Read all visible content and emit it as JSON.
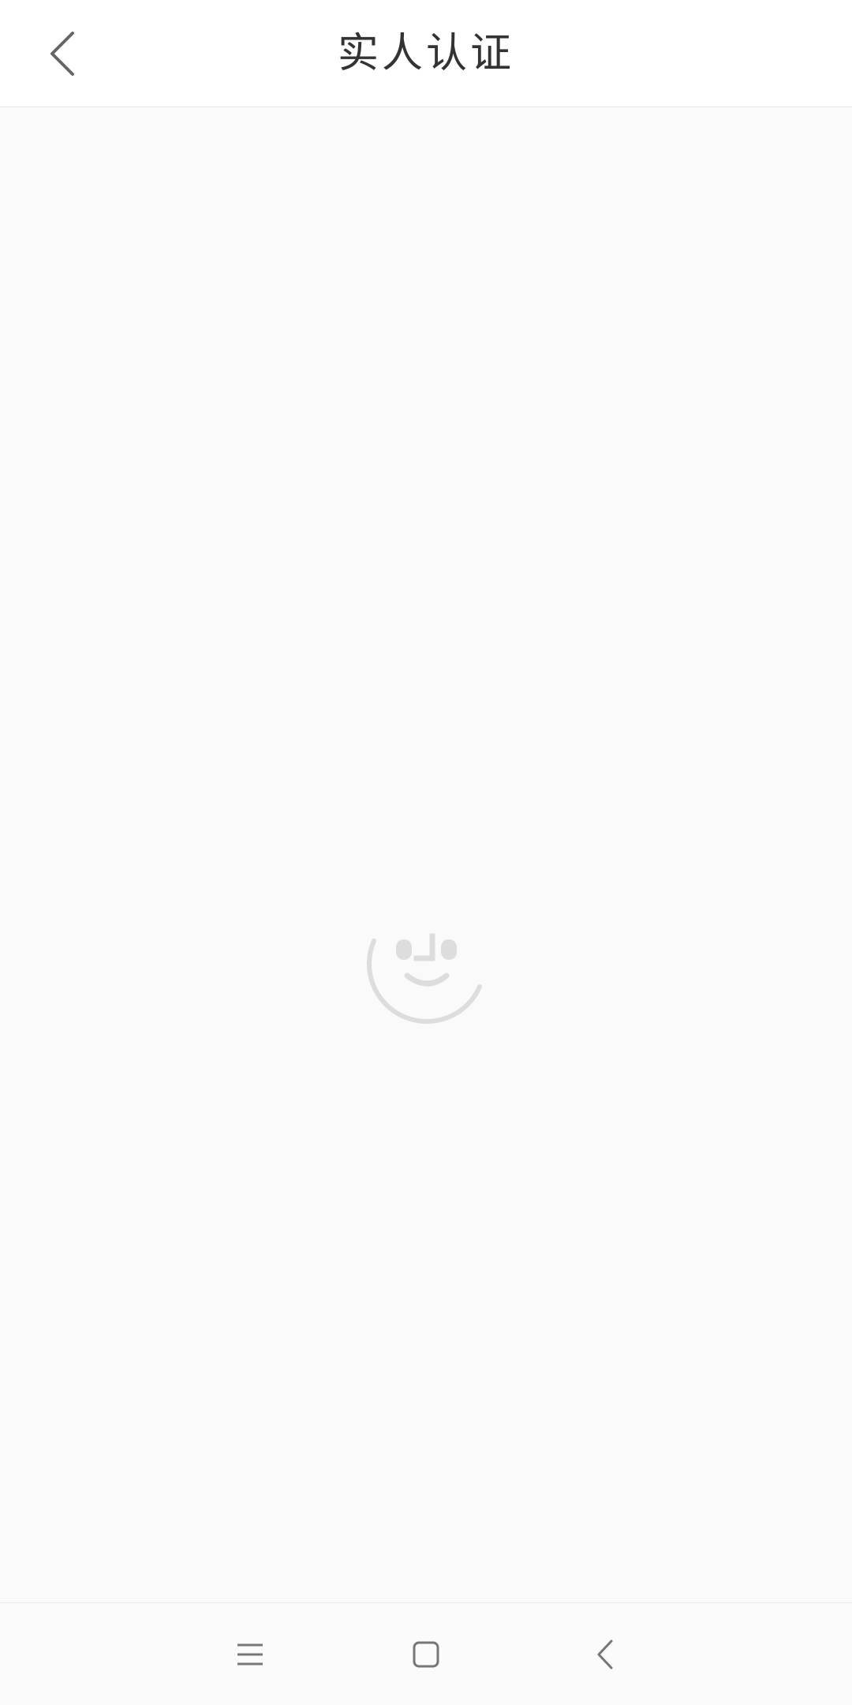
{
  "header": {
    "title": "实人认证",
    "back_icon": "chevron-left-icon"
  },
  "main": {
    "loading_icon": "smiley-face-loading-icon",
    "icon_color": "#dddddd"
  },
  "nav_bar": {
    "menu_icon": "menu-lines-icon",
    "home_icon": "square-home-icon",
    "back_icon": "chevron-left-icon"
  },
  "colors": {
    "header_bg": "#ffffff",
    "content_bg": "#fafafa",
    "title_text": "#333333",
    "icon_gray": "#666666"
  }
}
